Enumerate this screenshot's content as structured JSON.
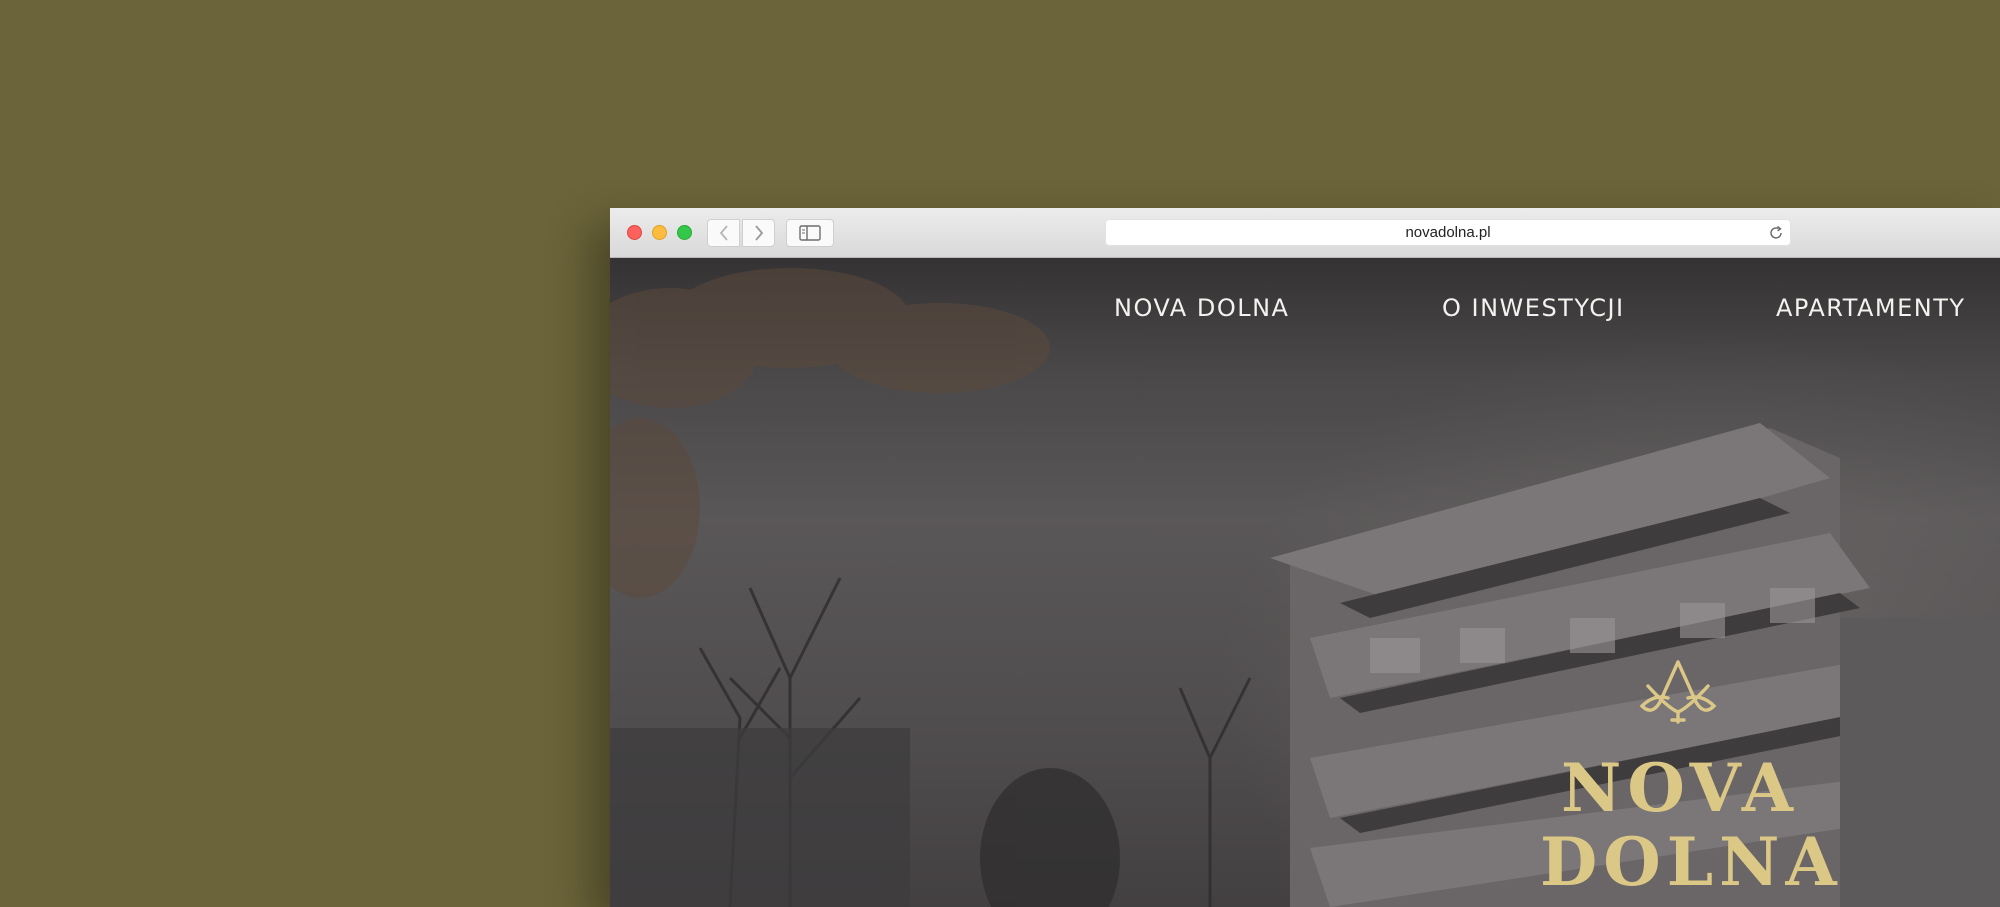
{
  "browser": {
    "url": "novadolna.pl",
    "icons": {
      "back": "chevron-left-icon",
      "forward": "chevron-right-icon",
      "sidebar": "sidebar-icon",
      "reload": "reload-icon"
    }
  },
  "site": {
    "nav": [
      "NOVA DOLNA",
      "O INWESTYCJI",
      "APARTAMENTY"
    ],
    "brand": {
      "line1": "NOVA",
      "line2": "DOLNA",
      "color": "#dcc886",
      "logo_icon": "crown-leaf-logo-icon"
    }
  },
  "colors": {
    "desktop_background": "#6b643a",
    "nav_text": "#f4f2ee"
  }
}
